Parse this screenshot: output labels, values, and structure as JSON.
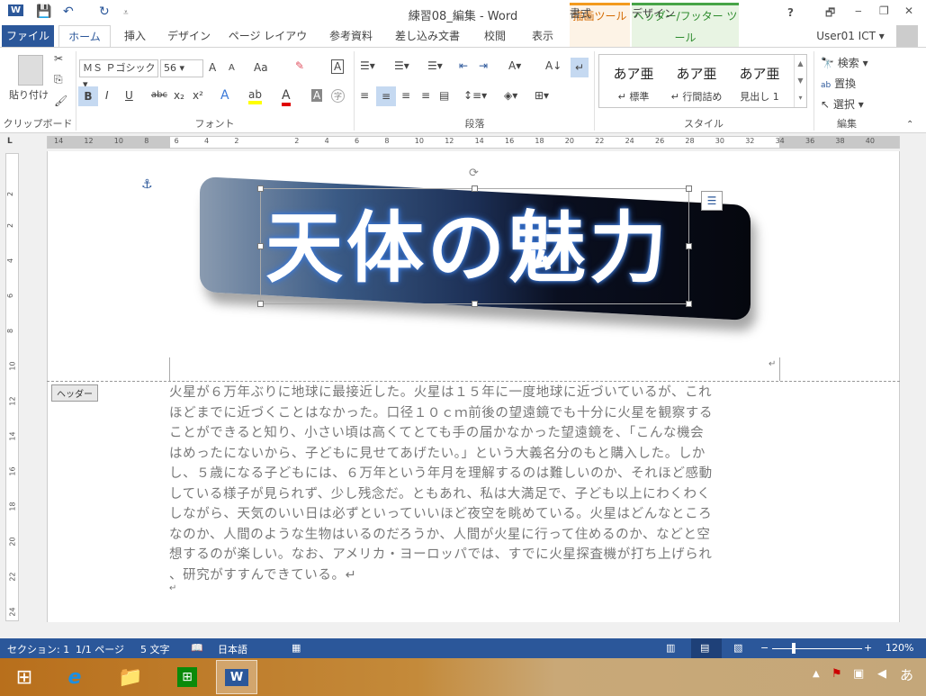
{
  "window": {
    "title": "練習08_編集 - Word",
    "help": "?",
    "restore": "🗗",
    "minimize": "‒",
    "maximize": "❐",
    "close": "✕"
  },
  "qat": {
    "word_icon": "W",
    "save": "💾",
    "undo": "↶",
    "redo": "↻",
    "more": "⩡"
  },
  "contextual": [
    {
      "group": "描画ツール",
      "tab": "書式",
      "color": "#f39a1e"
    },
    {
      "group": "ヘッダー/フッター ツール",
      "tab": "デザイン",
      "color": "#47a447"
    }
  ],
  "tabs": [
    "ファイル",
    "ホーム",
    "挿入",
    "デザイン",
    "ページ レイアウト",
    "参考資料",
    "差し込み文書",
    "校閲",
    "表示"
  ],
  "user": "User01 ICT",
  "ribbon": {
    "clipboard": {
      "paste": "貼り付け",
      "label": "クリップボード"
    },
    "font": {
      "name": "ＭＳ Ｐゴシック",
      "size": "56",
      "grow": "A",
      "shrink": "A",
      "case": "Aa",
      "bold": "B",
      "italic": "I",
      "underline": "U",
      "strike": "abc",
      "sub": "x₂",
      "sup": "x²",
      "label": "フォント"
    },
    "paragraph": {
      "label": "段落"
    },
    "styles": {
      "items": [
        {
          "preview": "あア亜",
          "name": "↵ 標準"
        },
        {
          "preview": "あア亜",
          "name": "↵ 行間詰め"
        },
        {
          "preview": "あア亜",
          "name": "見出し 1"
        }
      ],
      "label": "スタイル"
    },
    "editing": {
      "find": "検索",
      "replace": "置換",
      "select": "選択",
      "label": "編集"
    }
  },
  "ruler": {
    "h": [
      "14",
      "12",
      "10",
      "8",
      "6",
      "4",
      "2",
      "",
      "2",
      "4",
      "6",
      "8",
      "10",
      "12",
      "14",
      "16",
      "18",
      "20",
      "22",
      "24",
      "26",
      "28",
      "30",
      "32",
      "34",
      "36",
      "38",
      "40"
    ],
    "v": [
      "2",
      "2",
      "4",
      "6",
      "8",
      "10",
      "12",
      "14",
      "16",
      "18",
      "20",
      "22",
      "24"
    ]
  },
  "document": {
    "header_label": "ヘッダー",
    "wordart": "天体の魅力",
    "body_lines": [
      "火星が６万年ぶりに地球に最接近した。火星は１５年に一度地球に近づいているが、これ",
      "ほどまでに近づくことはなかった。口径１０ｃｍ前後の望遠鏡でも十分に火星を観察する",
      "ことができると知り、小さい頃は高くてとても手の届かなかった望遠鏡を、「こんな機会",
      "はめったにないから、子どもに見せてあげたい。」という大義名分のもと購入した。しか",
      "し、５歳になる子どもには、６万年という年月を理解するのは難しいのか、それほど感動",
      "している様子が見られず、少し残念だ。ともあれ、私は大満足で、子ども以上にわくわく",
      "しながら、天気のいい日は必ずといっていいほど夜空を眺めている。火星はどんなところ",
      "なのか、人間のような生物はいるのだろうか、人間が火星に行って住めるのか、などと空",
      "想するのが楽しい。なお、アメリカ・ヨーロッパでは、すでに火星探査機が打ち上げられ",
      "、研究がすすんできている。↵"
    ],
    "empty_para": "↵",
    "header_mark": "↵"
  },
  "status": {
    "section": "セクション: 1",
    "page": "1/1 ページ",
    "words": "5 文字",
    "language": "日本語",
    "zoom": "120%",
    "zoom_percent": 120
  }
}
